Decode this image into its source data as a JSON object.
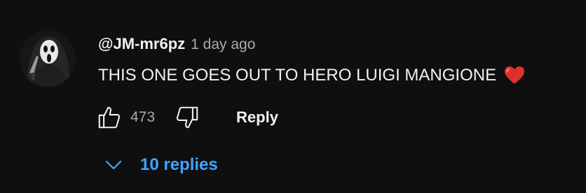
{
  "comment": {
    "author": "@JM-mr6pz",
    "timestamp": "1 day ago",
    "text": "THIS ONE GOES OUT TO HERO LUIGI MANGIONE",
    "emoji": "red-heart"
  },
  "actions": {
    "like_count": "473",
    "reply_label": "Reply"
  },
  "replies": {
    "label": "10 replies"
  },
  "colors": {
    "background": "#0f0f0f",
    "link_blue": "#3ea6ff",
    "muted": "#aaaaaa"
  }
}
